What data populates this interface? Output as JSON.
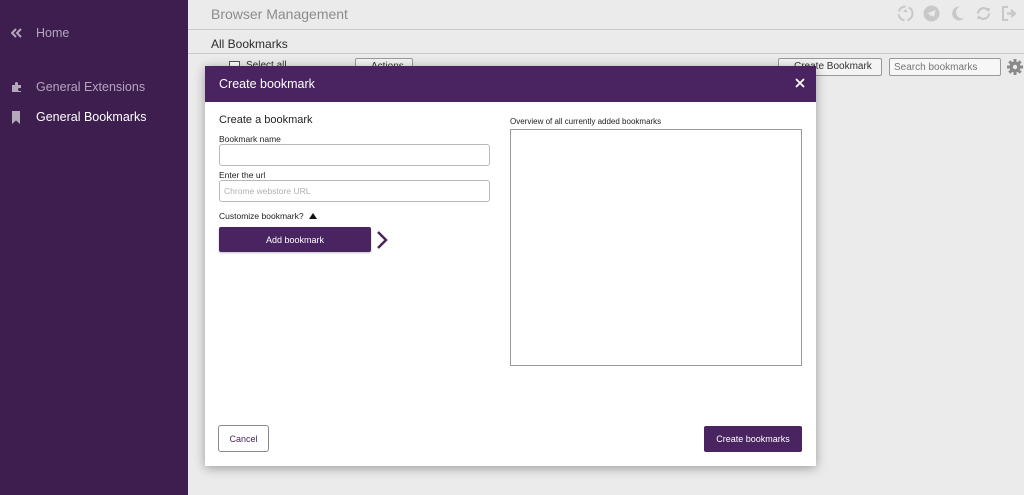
{
  "app": {
    "title": "Browser Management"
  },
  "sidebar": {
    "items": [
      {
        "label": "Home",
        "icon": "double-chevron-left-icon",
        "active": false
      },
      {
        "label": "General Extensions",
        "icon": "puzzle-icon",
        "active": false
      },
      {
        "label": "General Bookmarks",
        "icon": "bookmark-icon",
        "active": true
      }
    ]
  },
  "topbar": {
    "icons": [
      "recycle-icon",
      "telegram-icon",
      "moon-icon",
      "refresh-icon",
      "logout-icon"
    ]
  },
  "section": {
    "title": "All Bookmarks"
  },
  "background_toolbar": {
    "select_all_label": "Select all",
    "actions_label": "Actions",
    "create_button": "Create Bookmark",
    "search_placeholder": "Search bookmarks"
  },
  "modal": {
    "title": "Create bookmark",
    "form_heading": "Create a bookmark",
    "name_label": "Bookmark name",
    "name_value": "",
    "url_label": "Enter the url",
    "url_placeholder": "Chrome webstore URL",
    "customize_label": "Customize bookmark?",
    "add_button": "Add bookmark",
    "overview_label": "Overview of all currently added bookmarks",
    "cancel_button": "Cancel",
    "create_button": "Create bookmarks"
  },
  "colors": {
    "sidebar_bg": "#3e1d4f",
    "brand_purple": "#4a2460",
    "page_bg": "#ebebeb"
  }
}
